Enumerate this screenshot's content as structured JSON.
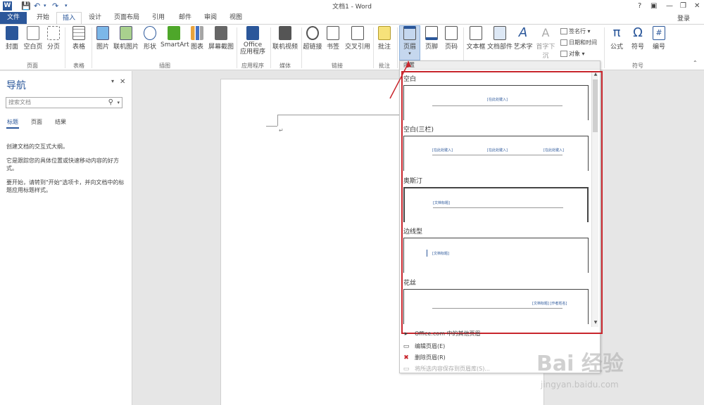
{
  "titlebar": {
    "logo": "W",
    "title": "文档1 - Word",
    "help": "?",
    "controls": [
      "▣",
      "—",
      "❐",
      "✕"
    ]
  },
  "tabs": {
    "file": "文件",
    "items": [
      "开始",
      "插入",
      "设计",
      "页面布局",
      "引用",
      "邮件",
      "审阅",
      "视图"
    ],
    "active": "插入",
    "login": "登录"
  },
  "ribbon": {
    "buttons": [
      "封面",
      "空白页",
      "分页",
      "表格",
      "图片",
      "联机图片",
      "形状",
      "SmartArt",
      "图表",
      "屏幕截图",
      "Office\n应用程序",
      "联机视频",
      "超链接",
      "书签",
      "交叉引用",
      "批注",
      "页眉",
      "页脚",
      "页码",
      "文本框",
      "文档部件",
      "艺术字",
      "首字下沉",
      "公式",
      "符号",
      "编号"
    ],
    "small": [
      "签名行",
      "日期和时间",
      "对象"
    ],
    "groups": [
      "页面",
      "表格",
      "插图",
      "应用程序",
      "媒体",
      "链接",
      "批注",
      "符号"
    ]
  },
  "nav": {
    "title": "导航",
    "search_placeholder": "搜索文档",
    "tabs": [
      "标题",
      "页面",
      "结果"
    ],
    "messages": [
      "创建文档的交互式大纲。",
      "它是跟踪您的具体位置或快速移动内容的好方式。",
      "要开始，请转到\"开始\"选项卡，并向文档中的标题应用标题样式。"
    ]
  },
  "gallery": {
    "header": "内置",
    "items": [
      {
        "name": "空白",
        "placeholders": [
          "[在此处键入]"
        ]
      },
      {
        "name": "空白(三栏)",
        "placeholders": [
          "[在此处键入]",
          "[在此处键入]",
          "[在此处键入]"
        ]
      },
      {
        "name": "奥斯汀",
        "placeholders": [
          "[文档标题]"
        ]
      },
      {
        "name": "边线型",
        "placeholders": [
          "[文档标题]"
        ]
      },
      {
        "name": "花丝",
        "placeholders": [
          "[文档标题] [作者姓名]"
        ]
      }
    ],
    "menu": [
      {
        "label": "Office.com 中的其他页眉",
        "disabled": false
      },
      {
        "label": "编辑页眉(E)",
        "disabled": false
      },
      {
        "label": "删除页眉(R)",
        "disabled": false
      },
      {
        "label": "将所选内容保存到页眉库(S)...",
        "disabled": true
      }
    ],
    "highlight_color": "#c8252c"
  },
  "watermark": {
    "text": "Bai 经验",
    "url": "jingyan.baidu.com"
  },
  "colors": {
    "accent": "#2b579a",
    "highlight": "#c8252c"
  }
}
